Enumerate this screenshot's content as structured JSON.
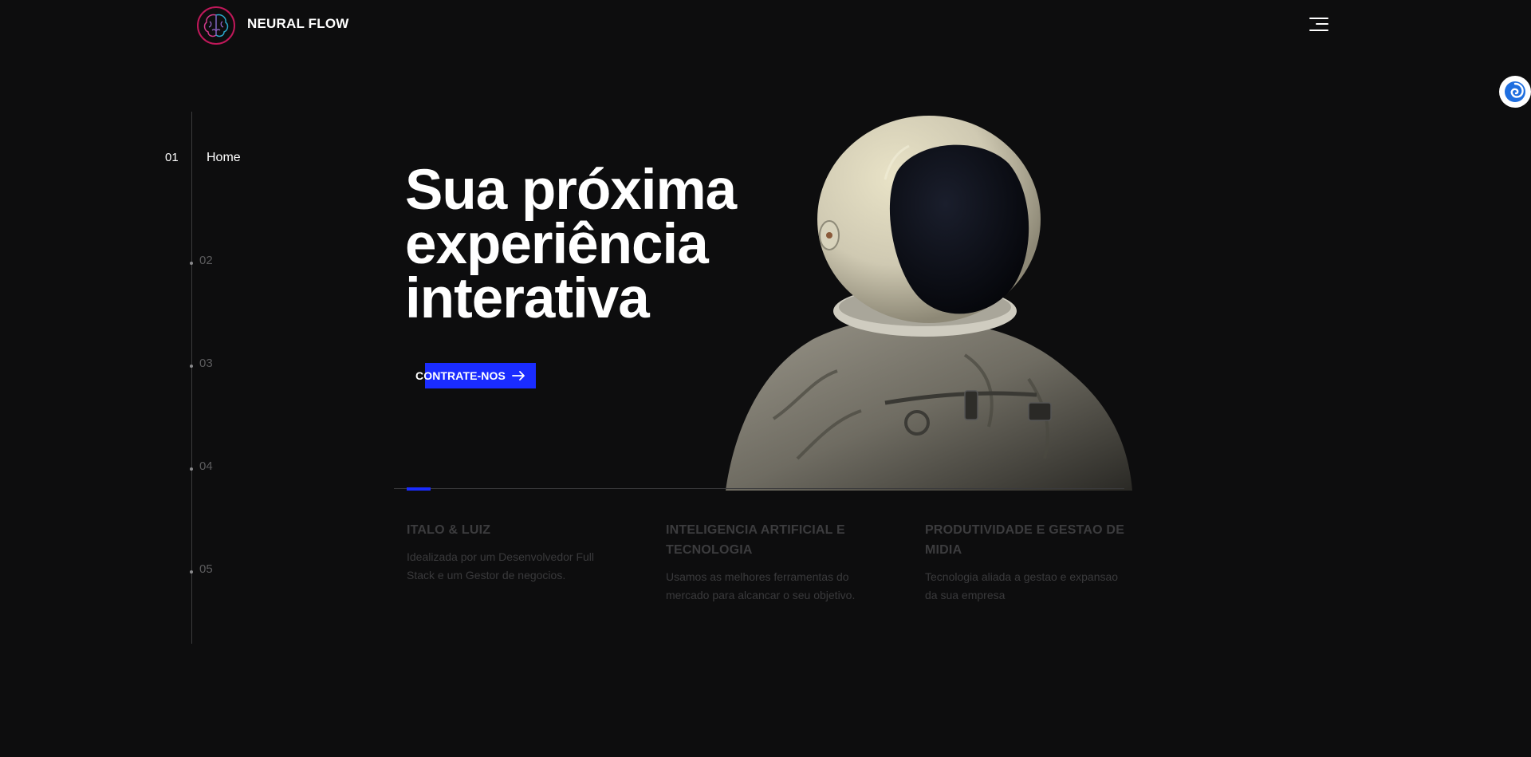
{
  "header": {
    "brand": "NEURAL FLOW",
    "logo_icon": "brain-logo-icon",
    "menu_icon": "hamburger-menu-icon"
  },
  "widget": {
    "icon": "swirl-widget-icon"
  },
  "side_nav": {
    "items": [
      {
        "number": "01",
        "label": "Home",
        "active": true
      },
      {
        "number": "02"
      },
      {
        "number": "03"
      },
      {
        "number": "04"
      },
      {
        "number": "05"
      }
    ]
  },
  "hero": {
    "title_line1": "Sua próxima",
    "title_line2": "experiência",
    "title_line3": "interativa",
    "cta_label": "CONTRATE-NOS",
    "cta_icon": "arrow-right-icon"
  },
  "features": [
    {
      "title": "ITALO & LUIZ",
      "text": "Idealizada por um Desenvolvedor Full Stack e um Gestor de negocios."
    },
    {
      "title": "INTELIGENCIA ARTIFICIAL E TECNOLOGIA",
      "text": "Usamos as melhores ferramentas do mercado para alcancar o seu objetivo."
    },
    {
      "title": "PRODUTIVIDADE E GESTAO DE MIDIA",
      "text": "Tecnologia aliada a gestao e expansao da sua empresa"
    }
  ],
  "colors": {
    "background": "#0d0d0e",
    "accent": "#1a2cff",
    "muted_text": "#3c3c3e"
  }
}
